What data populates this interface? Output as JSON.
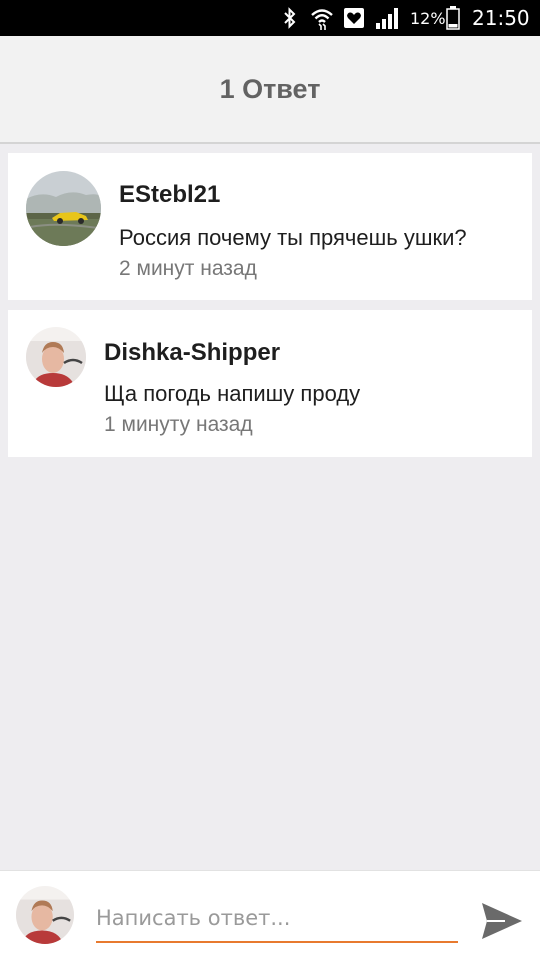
{
  "status_bar": {
    "battery_percent": "12%",
    "time": "21:50",
    "icons": [
      "bluetooth-icon",
      "wifi-icon",
      "heart-notification-icon",
      "signal-icon",
      "battery-icon"
    ]
  },
  "header": {
    "title": "1 Ответ"
  },
  "comments": [
    {
      "username": "EStebl21",
      "message": "Россия почему ты прячешь ушки?",
      "time": "2 минут назад"
    },
    {
      "username": "Dishka-Shipper",
      "message": "Ща погодь напишу проду",
      "time": "1 минуту назад"
    }
  ],
  "reply": {
    "placeholder": "Написать ответ...",
    "value": ""
  },
  "colors": {
    "accent": "#e87a2f",
    "background": "#eeedf0",
    "header_bg": "#f2f2f2",
    "send_icon": "#6a6a6a"
  }
}
